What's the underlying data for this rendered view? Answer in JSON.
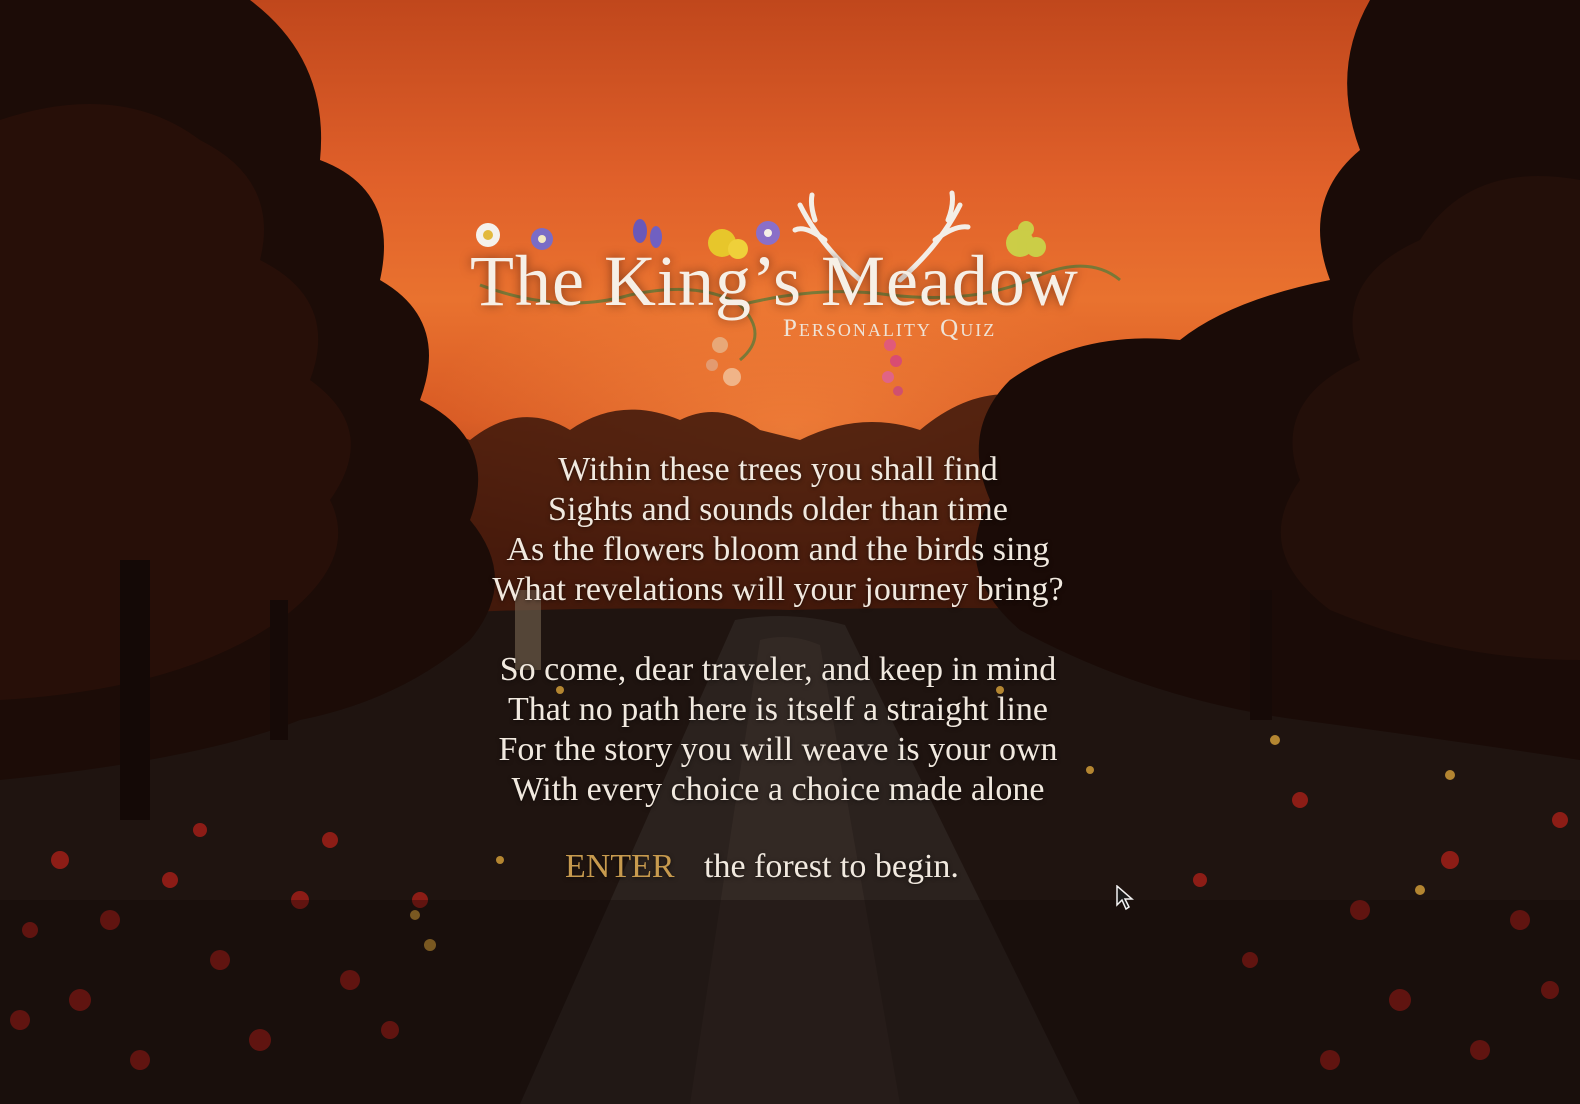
{
  "colors": {
    "sky_top": "#c0471c",
    "sky_glow": "#e9722f",
    "text": "#f1e9df",
    "enter_accent": "#c79a4e"
  },
  "logo": {
    "title": "The King’s Meadow",
    "subtitle": "Personality Quiz",
    "decorations": [
      "daisy-icon",
      "violet-icon",
      "bluebell-icon",
      "buttercup-icon",
      "antlers-icon",
      "wildflower-icon"
    ]
  },
  "poem": {
    "stanzas": [
      {
        "lines": [
          "Within these trees you shall find",
          "Sights and sounds older than time",
          "As the flowers bloom and the birds sing",
          "What revelations will your journey bring?"
        ]
      },
      {
        "lines": [
          "So come, dear traveler, and keep in mind",
          "That no path here is itself a straight line",
          "For the story you will weave is your own",
          "With every choice a choice made alone"
        ]
      }
    ]
  },
  "prompt": {
    "enter_label": "ENTER",
    "rest": "the forest to begin."
  },
  "cursor": {
    "icon": "mouse-pointer-icon"
  }
}
